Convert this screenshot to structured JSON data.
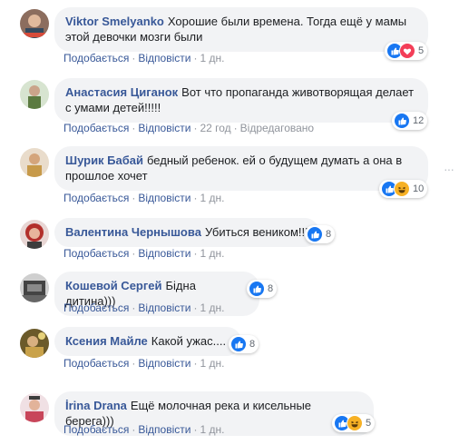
{
  "comments": [
    {
      "author": "Viktor Smelyanko",
      "text": "Хорошие были времена. Тогда ещё у мамы этой девочки мозги были",
      "like": "Подобається",
      "reply": "Відповісти",
      "time": "1 дн.",
      "edited": "",
      "reactions": [
        "like-icon",
        "love-icon"
      ],
      "reaction_count": "5",
      "avatar_color": "#7a5a4a"
    },
    {
      "author": "Анастасия Циганок",
      "text": "Вот что пропаганда животворящая делает с умами детей!!!!!",
      "like": "Подобається",
      "reply": "Відповісти",
      "time": "22 год",
      "edited": "Відредаговано",
      "reactions": [
        "like-icon"
      ],
      "reaction_count": "12",
      "avatar_color": "#6d8a56"
    },
    {
      "author": "Шурик Бабай",
      "text": "бедный ребенок. ей о будущем думать а она в прошлое хочет",
      "like": "Подобається",
      "reply": "Відповісти",
      "time": "1 дн.",
      "edited": "",
      "reactions": [
        "like-icon",
        "haha-icon"
      ],
      "reaction_count": "10",
      "avatar_color": "#c9a070"
    },
    {
      "author": "Валентина Чернышова",
      "text": "Убиться веником!!!",
      "like": "Подобається",
      "reply": "Відповісти",
      "time": "1 дн.",
      "edited": "",
      "reactions": [
        "like-icon"
      ],
      "reaction_count": "8",
      "avatar_color": "#b2302c"
    },
    {
      "author": "Кошевой Сергей",
      "text": "Бідна дитина)))",
      "like": "Подобається",
      "reply": "Відповісти",
      "time": "1 дн.",
      "edited": "",
      "reactions": [
        "like-icon"
      ],
      "reaction_count": "8",
      "avatar_color": "#555555"
    },
    {
      "author": "Ксения Майле",
      "text": "Какой ужас....",
      "like": "Подобається",
      "reply": "Відповісти",
      "time": "1 дн.",
      "edited": "",
      "reactions": [
        "like-icon"
      ],
      "reaction_count": "8",
      "avatar_color": "#8a7a3a"
    },
    {
      "author": "İrina Drana",
      "text": "Ещё молочная река и кисельные берега)))",
      "like": "Подобається",
      "reply": "Відповісти",
      "time": "1 дн.",
      "edited": "",
      "reactions": [
        "like-icon",
        "haha-icon"
      ],
      "reaction_count": "5",
      "avatar_color": "#c85a6a"
    }
  ],
  "colors": {
    "link": "#385898",
    "meta": "#90949c",
    "bubble": "#f2f3f5",
    "like": "#1877f2",
    "love": "#f33e58",
    "haha": "#f7b125"
  }
}
